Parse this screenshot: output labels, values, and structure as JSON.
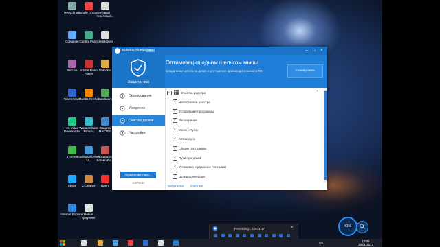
{
  "desktop_icons": [
    {
      "label": "Recycle Bin",
      "color": "#8aa"
    },
    {
      "label": "Google Chrome",
      "color": "#e44"
    },
    {
      "label": "Новый текстовый...",
      "color": "#ddd"
    },
    {
      "label": "Computer",
      "color": "#6af"
    },
    {
      "label": "Control Panel",
      "color": "#4a8"
    },
    {
      "label": "desktop.ini",
      "color": "#ddd"
    },
    {
      "label": "Recuva",
      "color": "#a6a"
    },
    {
      "label": "Adobe Flash Player",
      "color": "#c33"
    },
    {
      "label": "Unlocker",
      "color": "#da4"
    },
    {
      "label": "TeamViewer",
      "color": "#36c"
    },
    {
      "label": "Mozilla Firefox",
      "color": "#f80"
    },
    {
      "label": "Bandicam",
      "color": "#5a5"
    },
    {
      "label": "4K Video Downloader",
      "color": "#2c8"
    },
    {
      "label": "Wondershare Filmora",
      "color": "#3bc"
    },
    {
      "label": "Защита МАСТЕР",
      "color": "#48c"
    },
    {
      "label": "uTorrent",
      "color": "#4b4"
    },
    {
      "label": "Auslogics Driver U...",
      "color": "#49d"
    },
    {
      "label": "Архиватор Screen Re...",
      "color": "#c55"
    },
    {
      "label": "Skype",
      "color": "#2af"
    },
    {
      "label": "CCleaner",
      "color": "#c84"
    },
    {
      "label": "Opera",
      "color": "#e33"
    },
    {
      "label": "Internet Explorer",
      "color": "#38d"
    },
    {
      "label": "Новый документ",
      "color": "#ddd"
    }
  ],
  "app": {
    "title": "Malware Hunter",
    "badge": "PRO",
    "shield_label": "Защита: вкл",
    "header_title": "Оптимизация одним щелчком мыши",
    "header_subtitle": "Сохранение места на диске и улучшение производительности ПК",
    "scan_button": "Сканировать",
    "nav": [
      {
        "label": "Сканирование",
        "icon": "scan-icon",
        "active": false
      },
      {
        "label": "Ускорение",
        "icon": "rocket-icon",
        "active": false
      },
      {
        "label": "Очистка дисков",
        "icon": "disk-clean-icon",
        "active": true
      },
      {
        "label": "Настройки",
        "icon": "gear-icon",
        "active": false
      }
    ],
    "manage_button": "Управление лице...",
    "version": "1.27.0.44",
    "list_header": "Очистка реестра",
    "items": [
      "Целостность реестра",
      "Устаревшие программы",
      "Расширения",
      "Меню «Пуск»",
      "Автозапуск",
      "Общие программы",
      "Пути программ",
      "Установка и удаление программ",
      "Шрифты Windows"
    ],
    "select_all": "Выбрать все",
    "clear_all": "Снять все"
  },
  "recorder": {
    "status": "Recording... 00:03:17"
  },
  "gauge": {
    "value": "41%"
  },
  "taskbar": {
    "lang": "RU",
    "time": "10:06",
    "date": "19.01.2017"
  },
  "colors": {
    "accent": "#1f7fd8",
    "active_nav": "#2684d9"
  }
}
